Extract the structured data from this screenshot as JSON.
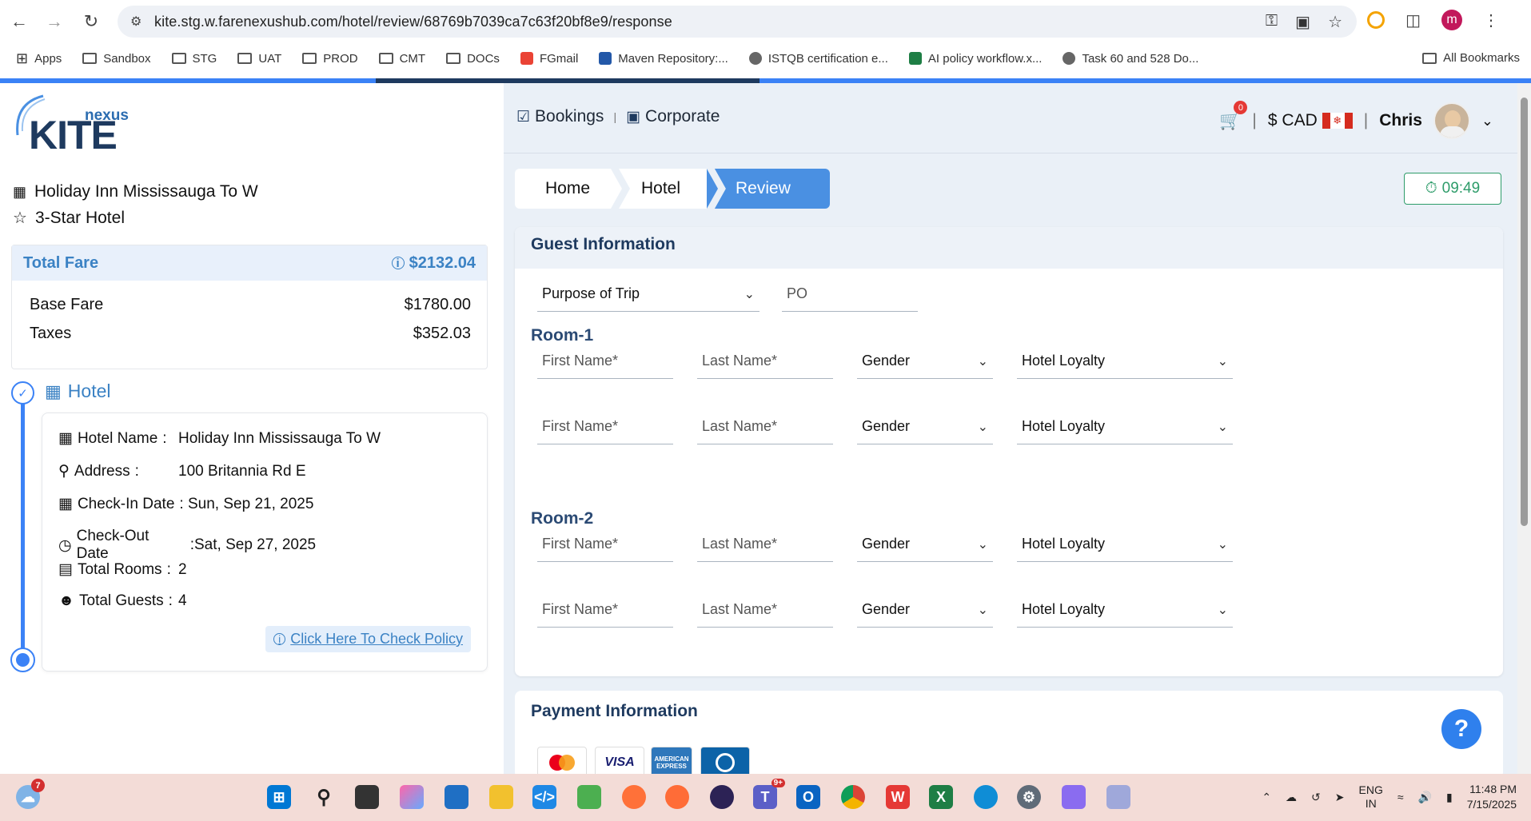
{
  "browser": {
    "url": "kite.stg.w.farenexushub.com/hotel/review/68769b7039ca7c63f20bf8e9/response",
    "profile_initial": "m",
    "bookmarks": [
      {
        "label": "Apps",
        "icon": "apps-grid-icon"
      },
      {
        "label": "Sandbox",
        "icon": "folder-icon"
      },
      {
        "label": "STG",
        "icon": "folder-icon"
      },
      {
        "label": "UAT",
        "icon": "folder-icon"
      },
      {
        "label": "PROD",
        "icon": "folder-icon"
      },
      {
        "label": "CMT",
        "icon": "folder-icon"
      },
      {
        "label": "DOCs",
        "icon": "folder-icon"
      },
      {
        "label": "FGmail",
        "icon": "gmail-icon"
      },
      {
        "label": "Maven Repository:...",
        "icon": "maven-icon"
      },
      {
        "label": "ISTQB certification e...",
        "icon": "globe-icon"
      },
      {
        "label": "AI policy workflow.x...",
        "icon": "excel-icon"
      },
      {
        "label": "Task 60 and 528 Do...",
        "icon": "globe-icon"
      }
    ],
    "all_bookmarks": "All Bookmarks"
  },
  "app": {
    "logo_small": "nexus",
    "logo_big": "KITE",
    "hotel_name_title": "Holiday Inn Mississauga To W",
    "hotel_stars": "3-Star Hotel",
    "fare": {
      "title": "Total Fare",
      "total": "$2132.04",
      "base_label": "Base Fare",
      "base_value": "$1780.00",
      "tax_label": "Taxes",
      "tax_value": "$352.03"
    },
    "hotel_section": {
      "heading": "Hotel",
      "rows": [
        {
          "label": "Hotel Name",
          "value": "Holiday Inn Mississauga To W"
        },
        {
          "label": "Address",
          "value": "100 Britannia Rd E"
        },
        {
          "label": "Check-In Date",
          "value": "Sun, Sep 21, 2025"
        },
        {
          "label": "Check-Out Date",
          "value": "Sat, Sep 27, 2025"
        },
        {
          "label": "Total Rooms",
          "value": "2"
        },
        {
          "label": "Total Guests",
          "value": "4"
        }
      ],
      "policy_link": "Click Here To Check Policy"
    },
    "nav": {
      "bookings": "Bookings",
      "corporate": "Corporate"
    },
    "header": {
      "cart_count": "0",
      "currency": "$ CAD",
      "user": "Chris"
    },
    "breadcrumbs": [
      "Home",
      "Hotel",
      "Review"
    ],
    "timer": "09:49",
    "guest_info": {
      "title": "Guest Information",
      "purpose": "Purpose of Trip",
      "po_placeholder": "PO",
      "first_name": "First Name*",
      "last_name": "Last Name*",
      "gender": "Gender",
      "loyalty": "Hotel Loyalty",
      "rooms": [
        "Room-1",
        "Room-2"
      ]
    },
    "payment": {
      "title": "Payment Information",
      "cards": [
        "mastercard",
        "VISA",
        "AMERICAN EXPRESS",
        "diners"
      ]
    },
    "help": "?"
  },
  "taskbar": {
    "weather_badge": "7",
    "teams_badge": "9+",
    "lang_top": "ENG",
    "lang_bottom": "IN",
    "time": "11:48 PM",
    "date": "7/15/2025"
  },
  "colors": {
    "accent": "#4a90e2",
    "timer": "#2e9c6a",
    "brand_dark": "#1e3a5f"
  }
}
